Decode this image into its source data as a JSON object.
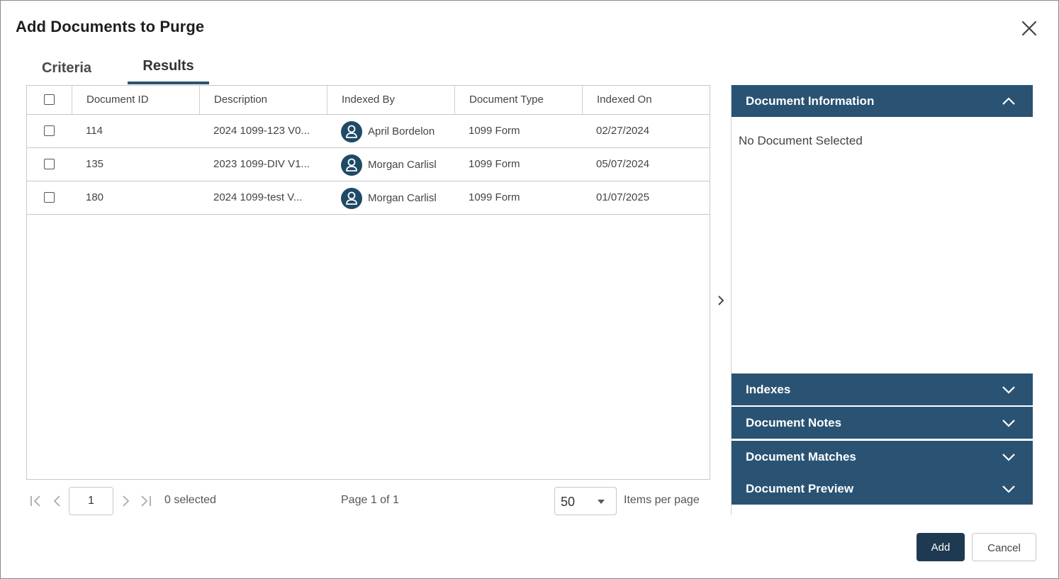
{
  "dialog": {
    "title": "Add Documents to Purge"
  },
  "tabs": [
    {
      "label": "Criteria",
      "active": false
    },
    {
      "label": "Results",
      "active": true
    }
  ],
  "grid": {
    "columns": [
      "Document ID",
      "Description",
      "Indexed By",
      "Document Type",
      "Indexed On"
    ],
    "rows": [
      {
        "id": "114",
        "description": "2024 1099-123 V0...",
        "indexed_by": "April Bordelon",
        "type": "1099 Form",
        "indexed_on": "02/27/2024"
      },
      {
        "id": "135",
        "description": "2023 1099-DIV V1...",
        "indexed_by": "Morgan Carlisl",
        "type": "1099 Form",
        "indexed_on": "05/07/2024"
      },
      {
        "id": "180",
        "description": "2024 1099-test V...",
        "indexed_by": "Morgan Carlisl",
        "type": "1099 Form",
        "indexed_on": "01/07/2025"
      }
    ]
  },
  "pager": {
    "page_input": "1",
    "selected_text": "0 selected",
    "page_text": "Page 1 of 1",
    "page_size": "50",
    "items_per_page_label": "Items per page"
  },
  "side_panel": {
    "document_information": "Document Information",
    "no_document": "No Document Selected",
    "indexes": "Indexes",
    "document_notes": "Document Notes",
    "document_matches": "Document Matches",
    "document_preview": "Document Preview"
  },
  "footer": {
    "add_label": "Add",
    "cancel_label": "Cancel"
  },
  "colors": {
    "accent": "#2a5373",
    "primary_button": "#1e3a52",
    "avatar": "#1e4a66"
  }
}
